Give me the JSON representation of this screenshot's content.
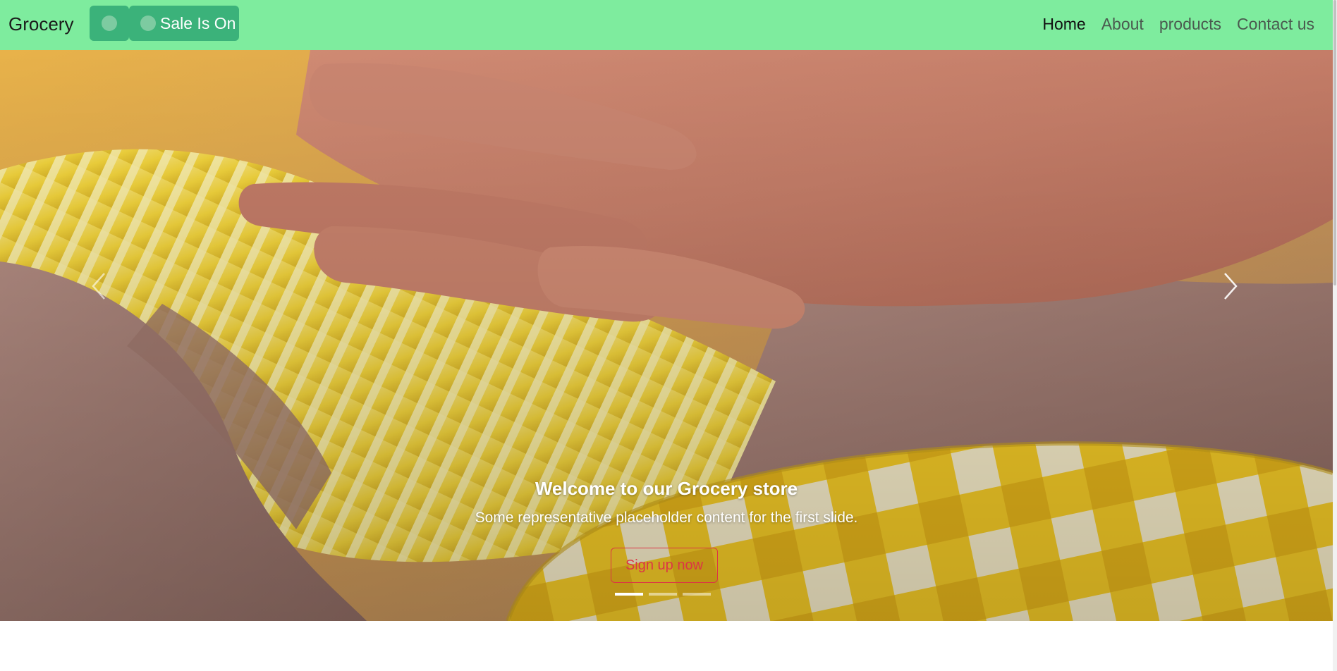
{
  "navbar": {
    "brand": "Grocery",
    "sale_toggle_label": "Sale Is On",
    "links": [
      {
        "label": "Home",
        "active": true
      },
      {
        "label": "About",
        "active": false
      },
      {
        "label": "products",
        "active": false
      },
      {
        "label": "Contact us",
        "active": false
      }
    ],
    "background_color": "#7eec9e",
    "toggle_color": "#3bb27a"
  },
  "carousel": {
    "slide": {
      "title": "Welcome to our Grocery store",
      "text": "Some representative placeholder content for the first slide.",
      "button_label": "Sign up now"
    },
    "indicator_count": 3,
    "active_indicator": 1,
    "prev_icon": "chevron-left-icon",
    "next_icon": "chevron-right-icon"
  },
  "colors": {
    "accent_danger": "#dc3545"
  }
}
